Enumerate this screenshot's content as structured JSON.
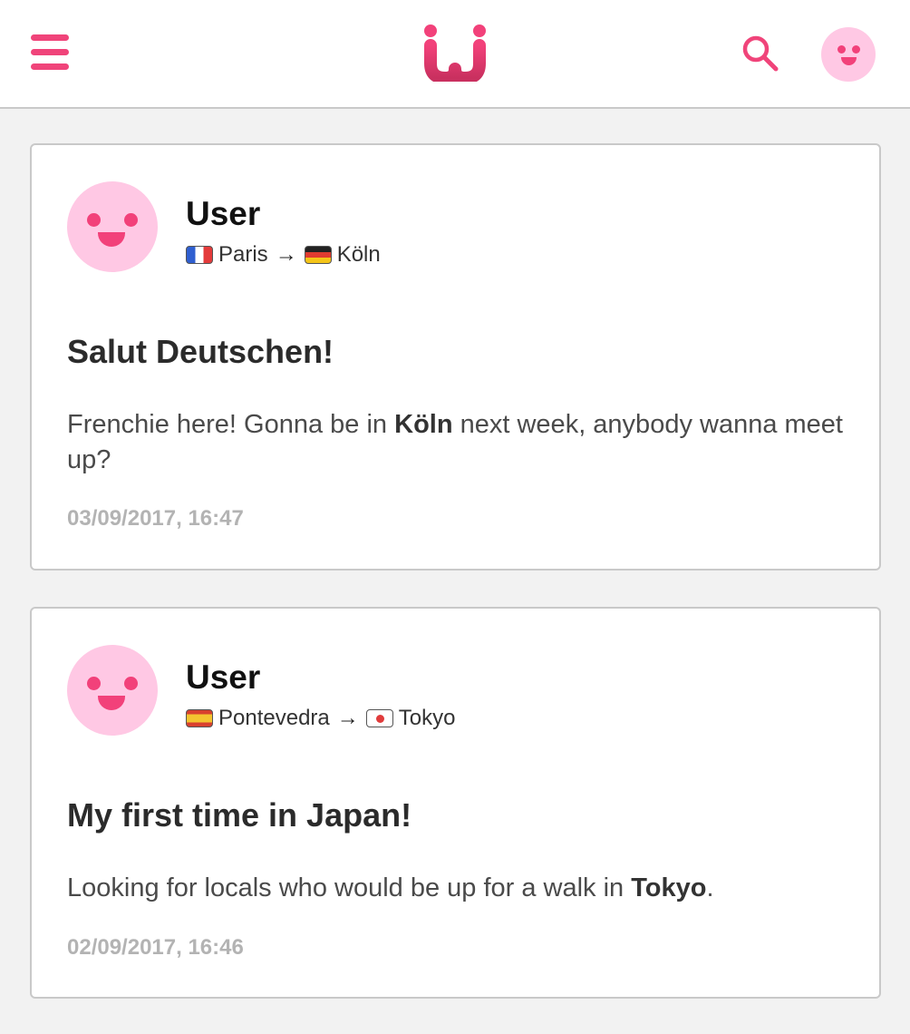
{
  "brand": {
    "accent": "#f0447a",
    "avatar_bg": "#ffc8e4"
  },
  "header": {
    "menu_icon": "hamburger-menu-icon",
    "logo_icon": "wi-logo-icon",
    "search_icon": "search-icon",
    "avatar_icon": "smiley-avatar-icon"
  },
  "posts": [
    {
      "username": "User",
      "from_city": "Paris",
      "from_flag": "flag-france-icon",
      "arrow": "→",
      "to_city": "Köln",
      "to_flag": "flag-germany-icon",
      "title": "Salut Deutschen!",
      "body_before": "Frenchie here! Gonna be in ",
      "body_bold": "Köln",
      "body_after": " next week, anybody wanna meet up?",
      "timestamp": "03/09/2017, 16:47"
    },
    {
      "username": "User",
      "from_city": "Pontevedra",
      "from_flag": "flag-spain-icon",
      "arrow": "→",
      "to_city": "Tokyo",
      "to_flag": "flag-japan-icon",
      "title": "My first time in Japan!",
      "body_before": "Looking for locals who would be up for a walk in ",
      "body_bold": "Tokyo",
      "body_after": ".",
      "timestamp": "02/09/2017, 16:46"
    }
  ]
}
